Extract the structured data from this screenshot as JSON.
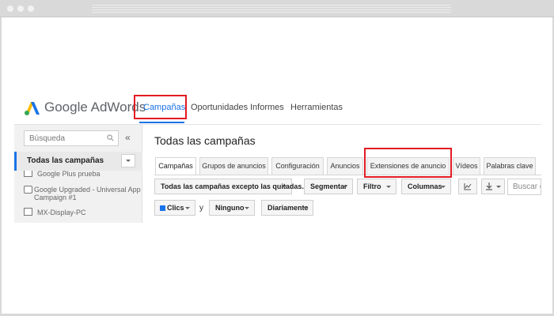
{
  "browser": {
    "dots": [
      "close-dot",
      "minimize-dot",
      "maximize-dot"
    ]
  },
  "header": {
    "brand": "Google AdWords",
    "nav": [
      {
        "label": "Campañas",
        "active": true
      },
      {
        "label": "Oportunidades",
        "active": false
      },
      {
        "label": "Informes",
        "active": false
      },
      {
        "label": "Herramientas",
        "active": false
      }
    ]
  },
  "sidebar": {
    "search_placeholder": "Búsqueda",
    "collapse": "«",
    "all_campaigns": "Todas las campañas",
    "campaigns": [
      {
        "name": "Google Plus prueba",
        "icon": "campaign-icon"
      },
      {
        "name": "Google Upgraded - Universal App Campaign #1",
        "line1": "Google Upgraded - Universal App",
        "line2": "Campaign #1",
        "icon": "app-campaign-icon"
      },
      {
        "name": "MX-Display-PC",
        "icon": "display-campaign-icon"
      }
    ]
  },
  "main": {
    "title": "Todas las campañas",
    "tabs": [
      {
        "label": "Campañas",
        "active": true
      },
      {
        "label": "Grupos de anuncios",
        "active": false
      },
      {
        "label": "Configuración",
        "active": false
      },
      {
        "label": "Anuncios",
        "active": false
      },
      {
        "label": "Extensiones de anuncio",
        "active": false
      },
      {
        "label": "Vídeos",
        "active": false
      },
      {
        "label": "Palabras clave",
        "active": false
      }
    ],
    "toolbar": {
      "filter_all": "Todas las campañas excepto las quitadas.",
      "segment": "Segmentar",
      "filter": "Filtro",
      "columns": "Columnas",
      "search_placeholder": "Buscar c"
    },
    "metrics": {
      "metric1": "Clics",
      "conjunction": "y",
      "metric2": "Ninguno",
      "period": "Diariamente"
    }
  },
  "colors": {
    "accent": "#1a73e8",
    "highlight": "#e21b22"
  }
}
